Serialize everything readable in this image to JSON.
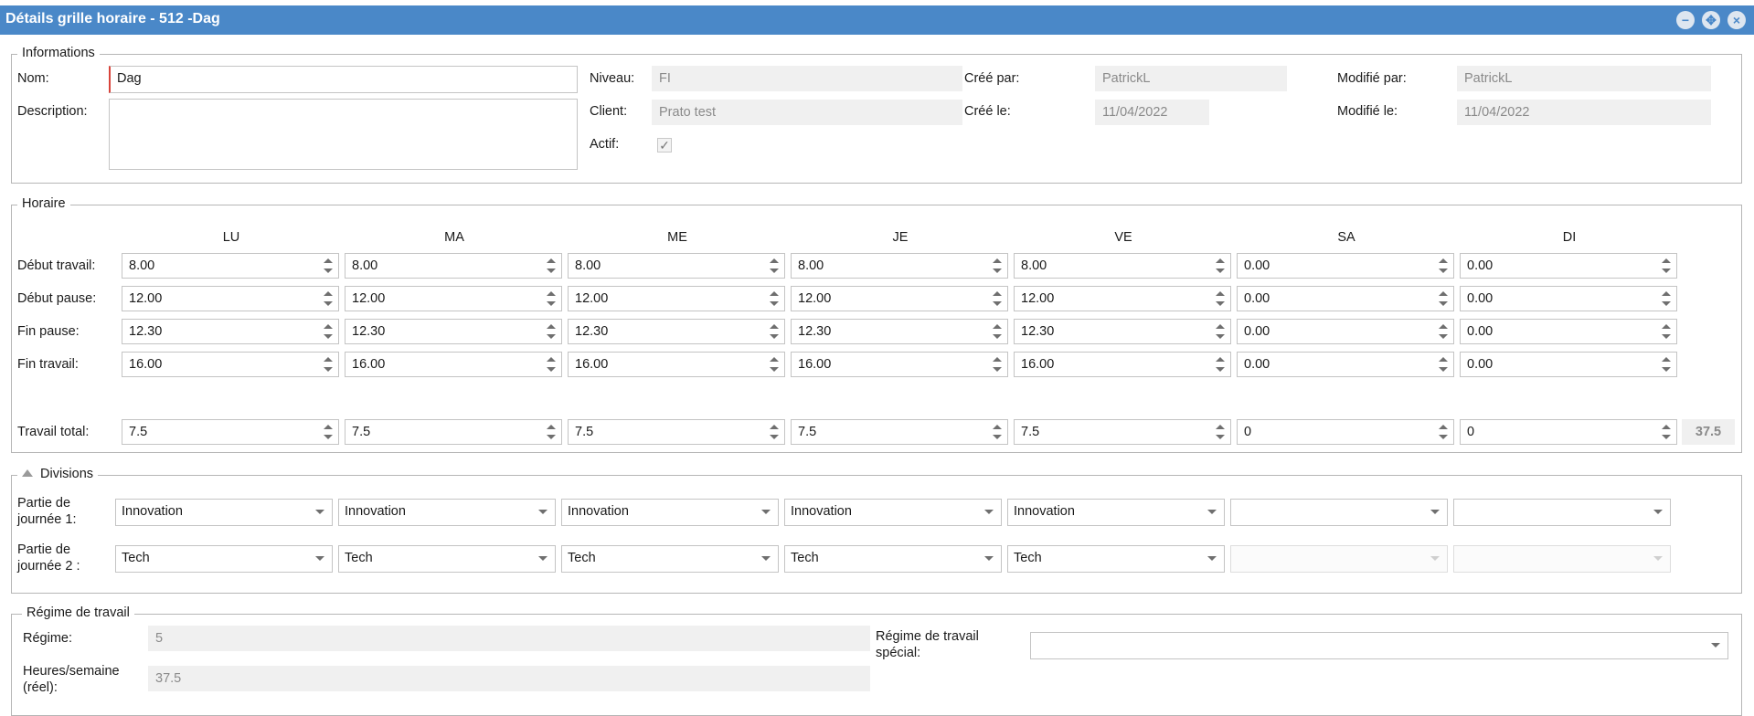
{
  "window": {
    "title": "Détails grille horaire - 512 -Dag"
  },
  "informations": {
    "legend": "Informations",
    "nom_label": "Nom:",
    "nom_value": "Dag",
    "description_label": "Description:",
    "description_value": "",
    "niveau_label": "Niveau:",
    "niveau_value": "FI",
    "client_label": "Client:",
    "client_value": "Prato test",
    "actif_label": "Actif:",
    "actif_checked": true,
    "cree_par_label": "Créé par:",
    "cree_par_value": "PatrickL",
    "cree_le_label": "Créé le:",
    "cree_le_value": "11/04/2022",
    "modifie_par_label": "Modifié par:",
    "modifie_par_value": "PatrickL",
    "modifie_le_label": "Modifié le:",
    "modifie_le_value": "11/04/2022"
  },
  "horaire": {
    "legend": "Horaire",
    "days": [
      "LU",
      "MA",
      "ME",
      "JE",
      "VE",
      "SA",
      "DI"
    ],
    "rows": [
      {
        "label": "Début travail:",
        "values": [
          "8.00",
          "8.00",
          "8.00",
          "8.00",
          "8.00",
          "0.00",
          "0.00"
        ]
      },
      {
        "label": "Début pause:",
        "values": [
          "12.00",
          "12.00",
          "12.00",
          "12.00",
          "12.00",
          "0.00",
          "0.00"
        ]
      },
      {
        "label": "Fin pause:",
        "values": [
          "12.30",
          "12.30",
          "12.30",
          "12.30",
          "12.30",
          "0.00",
          "0.00"
        ]
      },
      {
        "label": "Fin travail:",
        "values": [
          "16.00",
          "16.00",
          "16.00",
          "16.00",
          "16.00",
          "0.00",
          "0.00"
        ]
      }
    ],
    "total_label": "Travail total:",
    "total_values": [
      "7.5",
      "7.5",
      "7.5",
      "7.5",
      "7.5",
      "0",
      "0"
    ],
    "total_sum": "37.5"
  },
  "divisions": {
    "legend": "Divisions",
    "rows": [
      {
        "label_line1": "Partie de",
        "label_line2": "journée 1:",
        "values": [
          "Innovation",
          "Innovation",
          "Innovation",
          "Innovation",
          "Innovation",
          "",
          ""
        ],
        "disabled": [
          false,
          false,
          false,
          false,
          false,
          false,
          false
        ]
      },
      {
        "label_line1": "Partie de",
        "label_line2": "journée 2 :",
        "values": [
          "Tech",
          "Tech",
          "Tech",
          "Tech",
          "Tech",
          "",
          ""
        ],
        "disabled": [
          false,
          false,
          false,
          false,
          false,
          true,
          true
        ]
      }
    ]
  },
  "regime": {
    "legend": "Régime de travail",
    "regime_label": "Régime:",
    "regime_value": "5",
    "heures_label_line1": "Heures/semaine",
    "heures_label_line2": "(réel):",
    "heures_value": "37.5",
    "special_label_line1": "Régime de travail",
    "special_label_line2": "spécial:",
    "special_value": ""
  }
}
